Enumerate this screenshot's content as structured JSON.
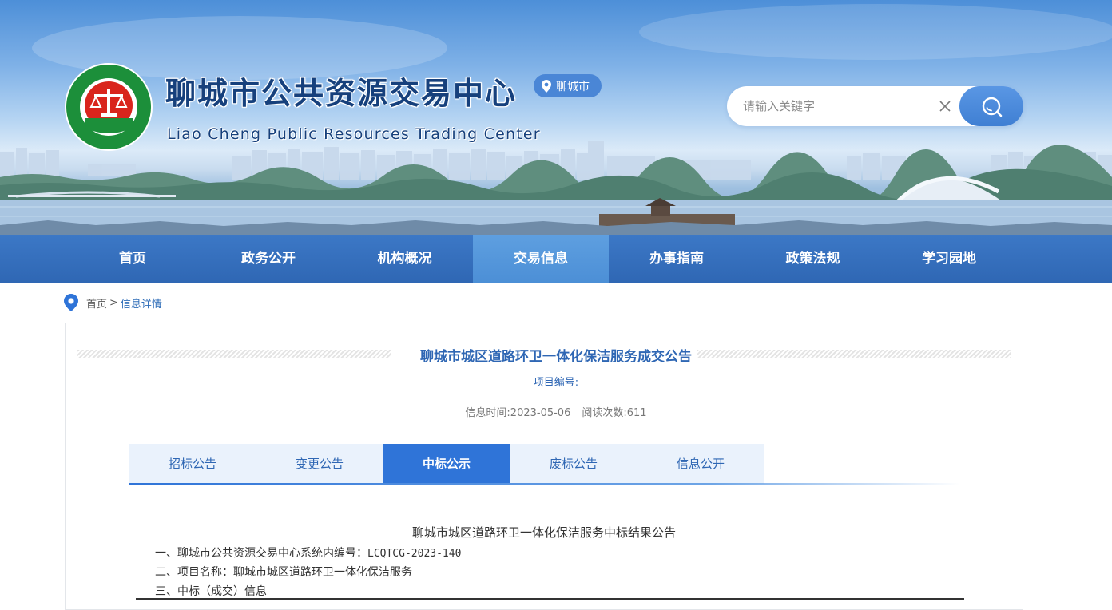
{
  "header": {
    "title": "聊城市公共资源交易中心",
    "subtitle": "Liao Cheng Public Resources Trading Center",
    "city": "聊城市",
    "logo_text": "聊城市公共资源交易中心",
    "logo_small_text": "LiaoCheng Public Resources Trading Center"
  },
  "search": {
    "placeholder": "请输入关键字",
    "value": ""
  },
  "nav": {
    "items": [
      {
        "label": "首页"
      },
      {
        "label": "政务公开"
      },
      {
        "label": "机构概况"
      },
      {
        "label": "交易信息"
      },
      {
        "label": "办事指南"
      },
      {
        "label": "政策法规"
      },
      {
        "label": "学习园地"
      }
    ],
    "active_index": 3
  },
  "breadcrumb": {
    "home": "首页",
    "separator": ">",
    "current": "信息详情"
  },
  "notice": {
    "title": "聊城市城区道路环卫一体化保洁服务成交公告",
    "project_no_label": "项目编号:",
    "time_label": "信息时间:",
    "time": "2023-05-06",
    "views_label": "阅读次数:",
    "views": "611"
  },
  "tabs": {
    "items": [
      {
        "label": "招标公告"
      },
      {
        "label": "变更公告"
      },
      {
        "label": "中标公示"
      },
      {
        "label": "废标公告"
      },
      {
        "label": "信息公开"
      }
    ],
    "active_index": 2
  },
  "document": {
    "title": "聊城市城区道路环卫一体化保洁服务中标结果公告",
    "line1_label": "一、聊城市公共资源交易中心系统内编号：",
    "line1_value": "LCQTCG-2023-140",
    "line2": "二、项目名称：聊城市城区道路环卫一体化保洁服务",
    "line3": "三、中标（成交）信息"
  },
  "colors": {
    "primary": "#2f67b4",
    "nav_bg": "#3570bd",
    "nav_active": "#5596dc",
    "tab_active": "#2f74d8",
    "logo_green": "#1c8f3a",
    "logo_red": "#d9251d"
  }
}
